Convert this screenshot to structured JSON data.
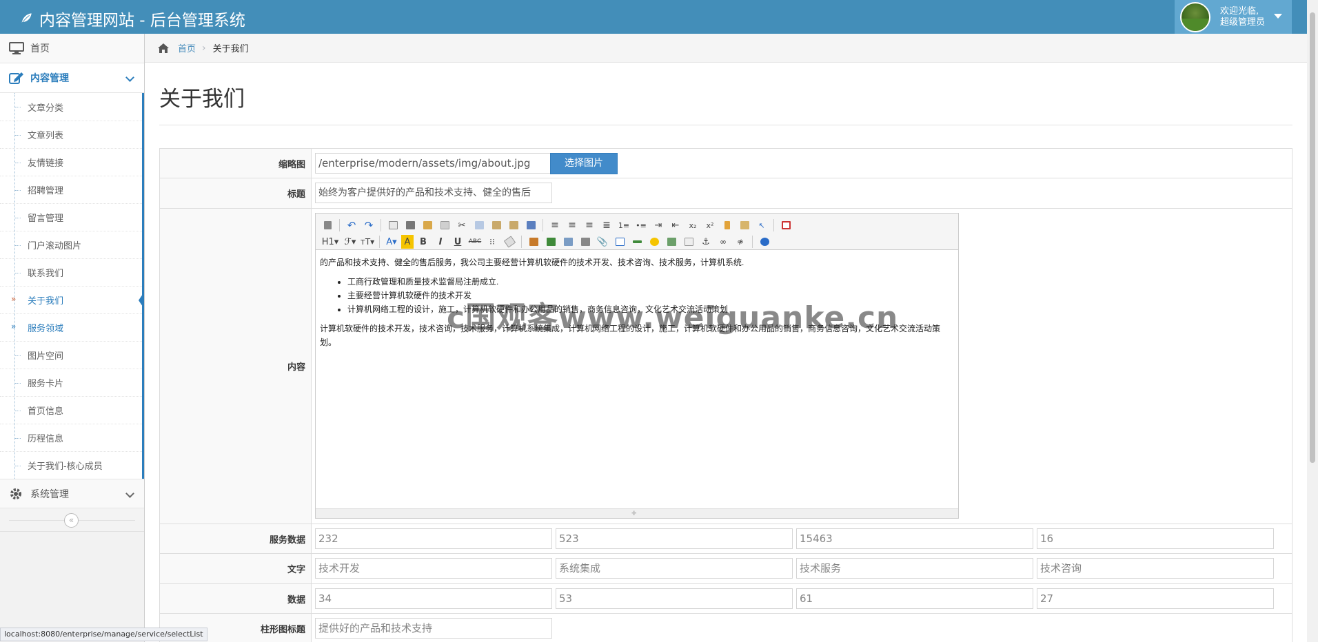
{
  "header": {
    "brand": "内容管理网站 - 后台管理系统",
    "user_greeting": "欢迎光临,",
    "user_role": "超级管理员"
  },
  "sidebar": {
    "home": "首页",
    "content_mgmt": "内容管理",
    "sub_items": [
      "文章分类",
      "文章列表",
      "友情链接",
      "招聘管理",
      "留言管理",
      "门户滚动图片",
      "联系我们",
      "关于我们",
      "服务领域",
      "图片空间",
      "服务卡片",
      "首页信息",
      "历程信息",
      "关于我们-核心成员"
    ],
    "system_mgmt": "系统管理"
  },
  "breadcrumb": {
    "home": "首页",
    "current": "关于我们"
  },
  "page": {
    "title": "关于我们"
  },
  "form": {
    "thumbnail_label": "缩略图",
    "thumbnail_value": "/enterprise/modern/assets/img/about.jpg",
    "select_image_btn": "选择图片",
    "title_label": "标题",
    "title_value": "始终为客户提供好的产品和技术支持、健全的售后",
    "content_label": "内容",
    "service_data_label": "服务数据",
    "service_data": [
      "232",
      "523",
      "15463",
      "16"
    ],
    "text_label": "文字",
    "text_values": [
      "技术开发",
      "系统集成",
      "技术服务",
      "技术咨询"
    ],
    "data_label": "数据",
    "data_values": [
      "34",
      "53",
      "61",
      "27"
    ],
    "bar_title_label": "柱形图标题",
    "bar_title_value": "提供好的产品和技术支持"
  },
  "editor": {
    "para1": "的产品和技术支持、健全的售后服务，我公司主要经营计算机软硬件的技术开发、技术咨询、技术服务，计算机系统.",
    "bullets": [
      "工商行政管理和质量技术监督局注册成立.",
      "主要经营计算机软硬件的技术开发",
      "计算机网络工程的设计，施工，计算机软硬件和办公用品的销售，商务信息咨询，文化艺术交流活动策划"
    ],
    "para2": "计算机软硬件的技术开发，技术咨询，技术服务，计算机系统集成，计算机网络工程的设计，施工，计算机软硬件和办公用品的销售，商务信息咨询，文化艺术交流活动策划。",
    "heading_btn": "H1",
    "watermark": "c国观客www.weiguanke.cn"
  },
  "status_url": "localhost:8080/enterprise/manage/service/selectList"
}
